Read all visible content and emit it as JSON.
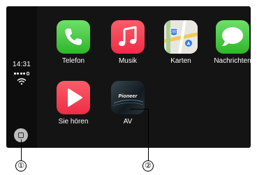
{
  "status": {
    "time": "14:31"
  },
  "apps": [
    {
      "label": "Telefon",
      "icon": "phone-icon"
    },
    {
      "label": "Musik",
      "icon": "music-note-icon"
    },
    {
      "label": "Karten",
      "icon": "maps-icon"
    },
    {
      "label": "Nachrichten",
      "icon": "speech-bubble-icon"
    },
    {
      "label": "Sie hören",
      "icon": "play-icon"
    },
    {
      "label": "AV",
      "icon": "pioneer-av-icon"
    }
  ],
  "pioneer_logo_text": "Pioneer",
  "maps_badge": "280",
  "callouts": [
    {
      "number": "①",
      "target": "home button"
    },
    {
      "number": "②",
      "target": "AV app icon"
    }
  ],
  "colors": {
    "screen_bg": "#141414",
    "green": "#2fb52a",
    "red": "#ee2c46"
  }
}
